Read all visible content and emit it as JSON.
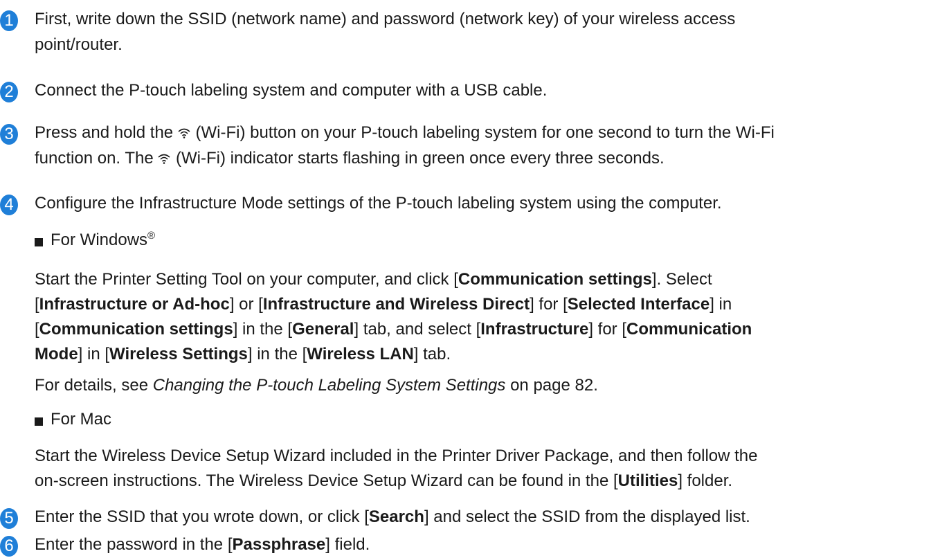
{
  "steps": [
    {
      "num": "1",
      "lines": [
        "First, write down the SSID (network name) and password (network key) of your wireless access",
        "point/router."
      ]
    },
    {
      "num": "2",
      "line": "Connect the P-touch labeling system and computer with a USB cable."
    },
    {
      "num": "3",
      "line1_a": "Press and hold the ",
      "line1_b": " (Wi-Fi) button on your P-touch labeling system  for one second to turn the Wi-Fi",
      "line2_a": "function on. The ",
      "line2_b": " (Wi-Fi) indicator starts flashing in green once every three seconds."
    },
    {
      "num": "4",
      "line": "Configure the Infrastructure Mode settings of the P-touch labeling system using the computer.",
      "windows": {
        "title": "For Windows",
        "reg": "®",
        "p1": {
          "a": "Start the Printer Setting Tool on your computer, and click [",
          "b": "Communication settings",
          "c": "]. Select"
        },
        "p2": {
          "a": "[",
          "b": "Infrastructure or Ad-hoc",
          "c": "] or [",
          "d": "Infrastructure and Wireless Direct",
          "e": "] for [",
          "f": "Selected Interface",
          "g": "] in"
        },
        "p3": {
          "a": "[",
          "b": "Communication settings",
          "c": "] in the [",
          "d": "General",
          "e": "] tab, and select [",
          "f": "Infrastructure",
          "g": "] for [",
          "h": "Communication"
        },
        "p4": {
          "a": "Mode",
          "b": "] in [",
          "c": "Wireless Settings",
          "d": "] in the [",
          "e": "Wireless LAN",
          "f": "] tab."
        },
        "details": {
          "a": "For details, see ",
          "b": "Changing the P-touch Labeling System Settings",
          "c": " on page 82."
        }
      },
      "mac": {
        "title": "For Mac",
        "p1": "Start the Wireless Device Setup Wizard included in the Printer Driver Package, and then follow the",
        "p2": {
          "a": "on-screen instructions. The Wireless Device Setup Wizard can be found in the [",
          "b": "Utilities",
          "c": "] folder."
        }
      }
    },
    {
      "num": "5",
      "a": "Enter the SSID that you wrote down, or click [",
      "b": "Search",
      "c": "] and select the SSID from the displayed list."
    },
    {
      "num": "6",
      "a": "Enter the password in the [",
      "b": "Passphrase",
      "c": "] field."
    }
  ],
  "colors": {
    "badge": "#1f7fd8",
    "text": "#1a1a1a"
  },
  "icons": {
    "wifi": "wifi-icon",
    "bullet": "square-bullet-icon"
  }
}
